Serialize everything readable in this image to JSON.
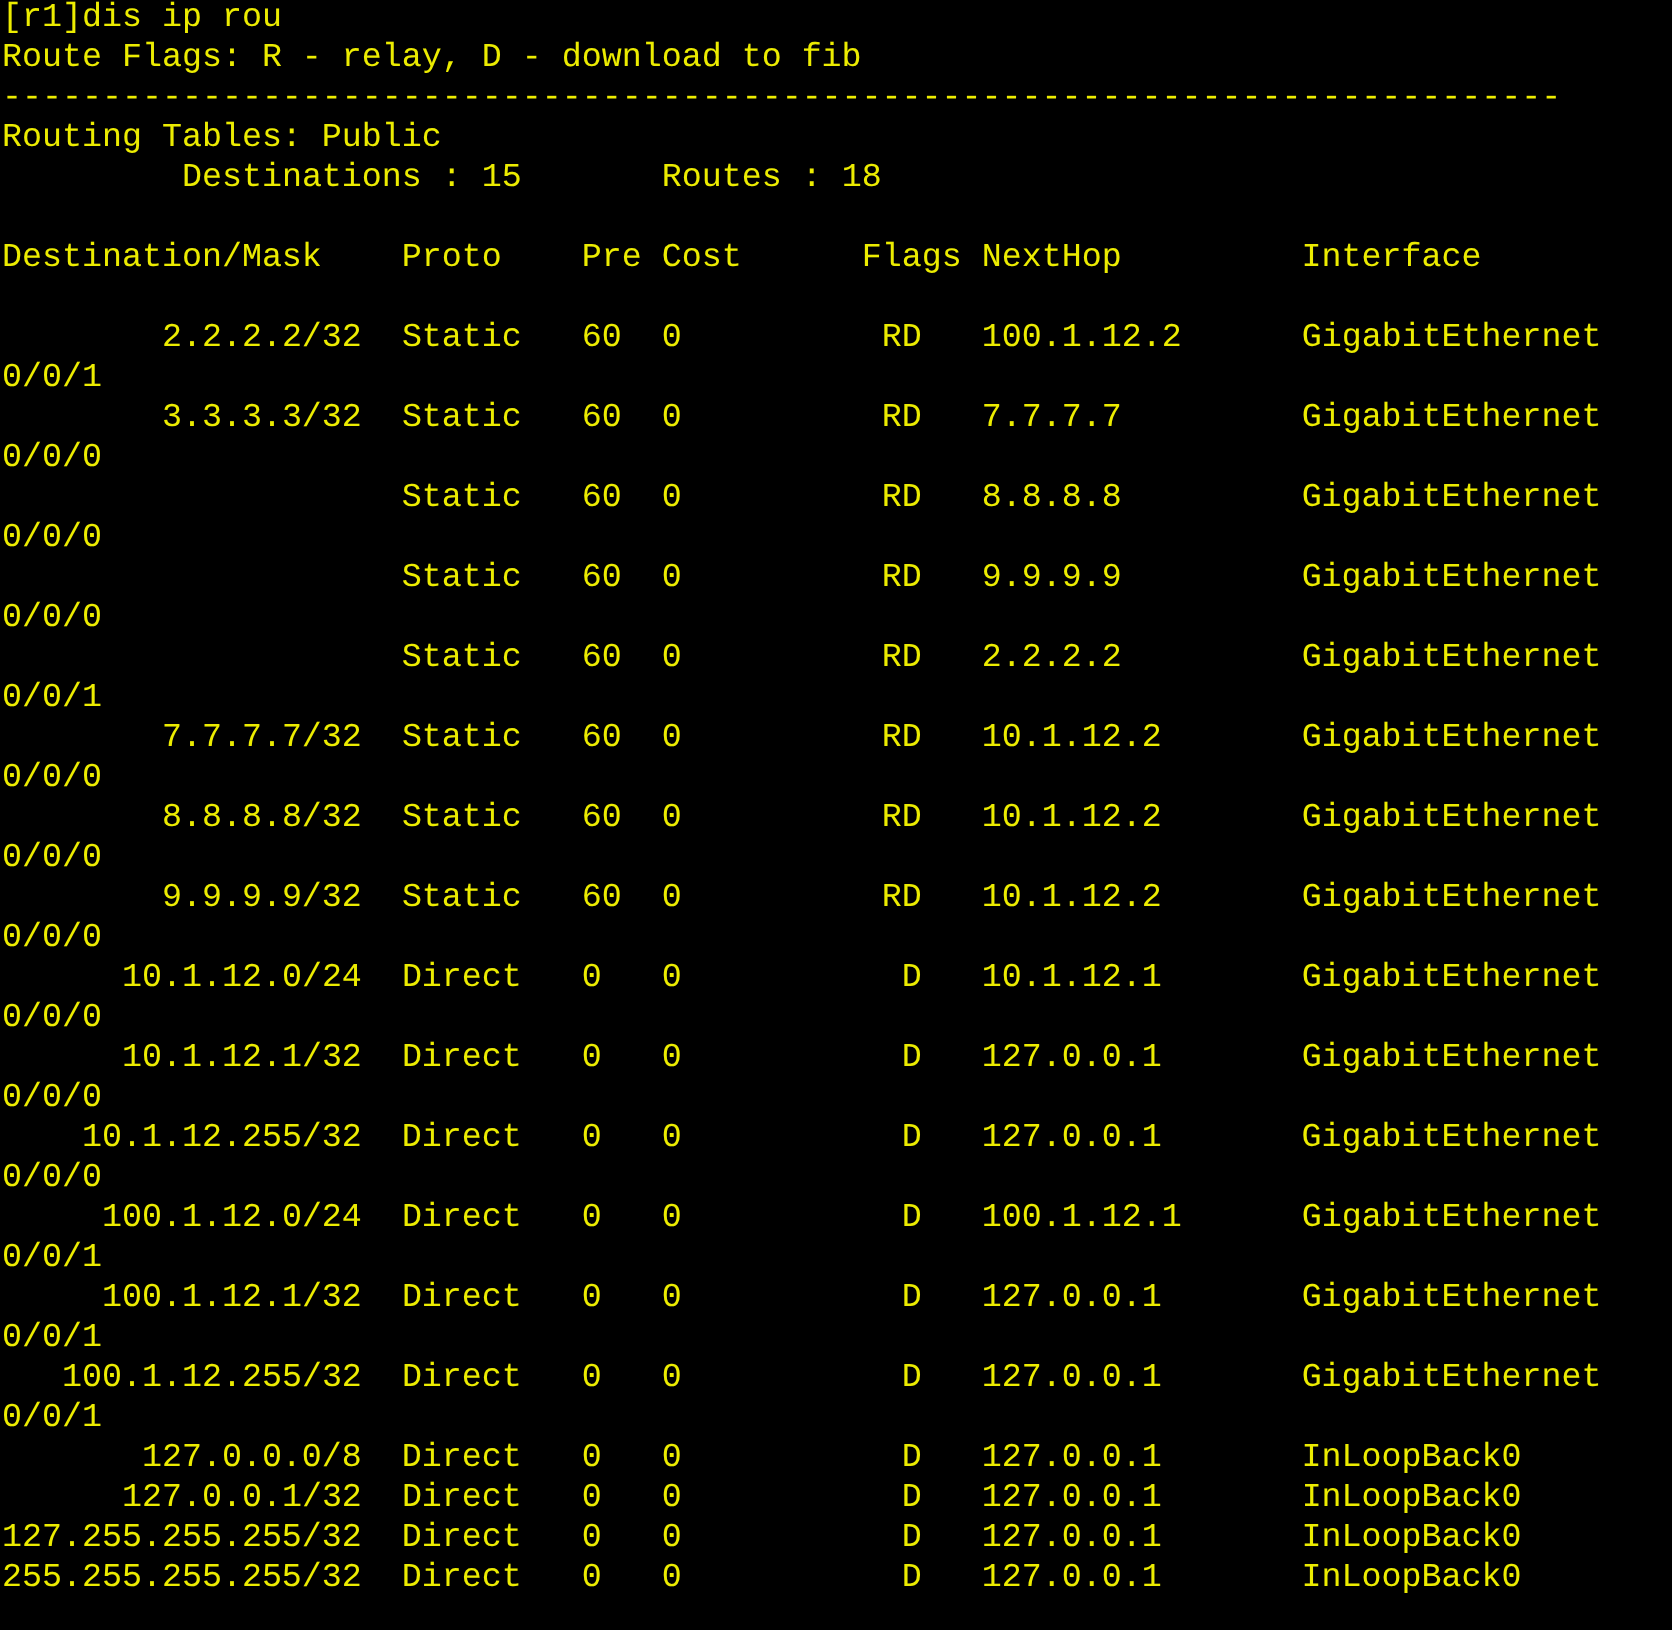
{
  "command": {
    "prompt": "[r1]",
    "text": "dis ip rou"
  },
  "route_flags": "Route Flags: R - relay, D - download to fib",
  "separator": "------------------------------------------------------------------------------",
  "routing_tables": "Routing Tables: Public",
  "summary": {
    "destinations_label": "Destinations :",
    "destinations": "15",
    "routes_label": "Routes :",
    "routes": "18"
  },
  "columns": [
    "Destination/Mask",
    "Proto",
    "Pre",
    "Cost",
    "Flags",
    "NextHop",
    "Interface"
  ],
  "rows": [
    {
      "destination": "2.2.2.2/32",
      "proto": "Static",
      "pre": "60",
      "cost": "0",
      "flags": "RD",
      "nexthop": "100.1.12.2",
      "interface": [
        "GigabitEthernet",
        "0/0/1"
      ]
    },
    {
      "destination": "3.3.3.3/32",
      "proto": "Static",
      "pre": "60",
      "cost": "0",
      "flags": "RD",
      "nexthop": "7.7.7.7",
      "interface": [
        "GigabitEthernet",
        "0/0/0"
      ]
    },
    {
      "proto": "Static",
      "pre": "60",
      "cost": "0",
      "flags": "RD",
      "nexthop": "8.8.8.8",
      "interface": [
        "GigabitEthernet",
        "0/0/0"
      ]
    },
    {
      "proto": "Static",
      "pre": "60",
      "cost": "0",
      "flags": "RD",
      "nexthop": "9.9.9.9",
      "interface": [
        "GigabitEthernet",
        "0/0/0"
      ]
    },
    {
      "proto": "Static",
      "pre": "60",
      "cost": "0",
      "flags": "RD",
      "nexthop": "2.2.2.2",
      "interface": [
        "GigabitEthernet",
        "0/0/1"
      ]
    },
    {
      "destination": "7.7.7.7/32",
      "proto": "Static",
      "pre": "60",
      "cost": "0",
      "flags": "RD",
      "nexthop": "10.1.12.2",
      "interface": [
        "GigabitEthernet",
        "0/0/0"
      ]
    },
    {
      "destination": "8.8.8.8/32",
      "proto": "Static",
      "pre": "60",
      "cost": "0",
      "flags": "RD",
      "nexthop": "10.1.12.2",
      "interface": [
        "GigabitEthernet",
        "0/0/0"
      ]
    },
    {
      "destination": "9.9.9.9/32",
      "proto": "Static",
      "pre": "60",
      "cost": "0",
      "flags": "RD",
      "nexthop": "10.1.12.2",
      "interface": [
        "GigabitEthernet",
        "0/0/0"
      ]
    },
    {
      "destination": "10.1.12.0/24",
      "proto": "Direct",
      "pre": "0",
      "cost": "0",
      "flags": "D",
      "nexthop": "10.1.12.1",
      "interface": [
        "GigabitEthernet",
        "0/0/0"
      ]
    },
    {
      "destination": "10.1.12.1/32",
      "proto": "Direct",
      "pre": "0",
      "cost": "0",
      "flags": "D",
      "nexthop": "127.0.0.1",
      "interface": [
        "GigabitEthernet",
        "0/0/0"
      ]
    },
    {
      "destination": "10.1.12.255/32",
      "proto": "Direct",
      "pre": "0",
      "cost": "0",
      "flags": "D",
      "nexthop": "127.0.0.1",
      "interface": [
        "GigabitEthernet",
        "0/0/0"
      ]
    },
    {
      "destination": "100.1.12.0/24",
      "proto": "Direct",
      "pre": "0",
      "cost": "0",
      "flags": "D",
      "nexthop": "100.1.12.1",
      "interface": [
        "GigabitEthernet",
        "0/0/1"
      ]
    },
    {
      "destination": "100.1.12.1/32",
      "proto": "Direct",
      "pre": "0",
      "cost": "0",
      "flags": "D",
      "nexthop": "127.0.0.1",
      "interface": [
        "GigabitEthernet",
        "0/0/1"
      ]
    },
    {
      "destination": "100.1.12.255/32",
      "proto": "Direct",
      "pre": "0",
      "cost": "0",
      "flags": "D",
      "nexthop": "127.0.0.1",
      "interface": [
        "GigabitEthernet",
        "0/0/1"
      ]
    },
    {
      "destination": "127.0.0.0/8",
      "proto": "Direct",
      "pre": "0",
      "cost": "0",
      "flags": "D",
      "nexthop": "127.0.0.1",
      "interface": "InLoopBack0"
    },
    {
      "destination": "127.0.0.1/32",
      "proto": "Direct",
      "pre": "0",
      "cost": "0",
      "flags": "D",
      "nexthop": "127.0.0.1",
      "interface": "InLoopBack0"
    },
    {
      "destination": "127.255.255.255/32",
      "proto": "Direct",
      "pre": "0",
      "cost": "0",
      "flags": "D",
      "nexthop": "127.0.0.1",
      "interface": "InLoopBack0"
    },
    {
      "destination": "255.255.255.255/32",
      "proto": "Direct",
      "pre": "0",
      "cost": "0",
      "flags": "D",
      "nexthop": "127.0.0.1",
      "interface": "InLoopBack0"
    }
  ]
}
